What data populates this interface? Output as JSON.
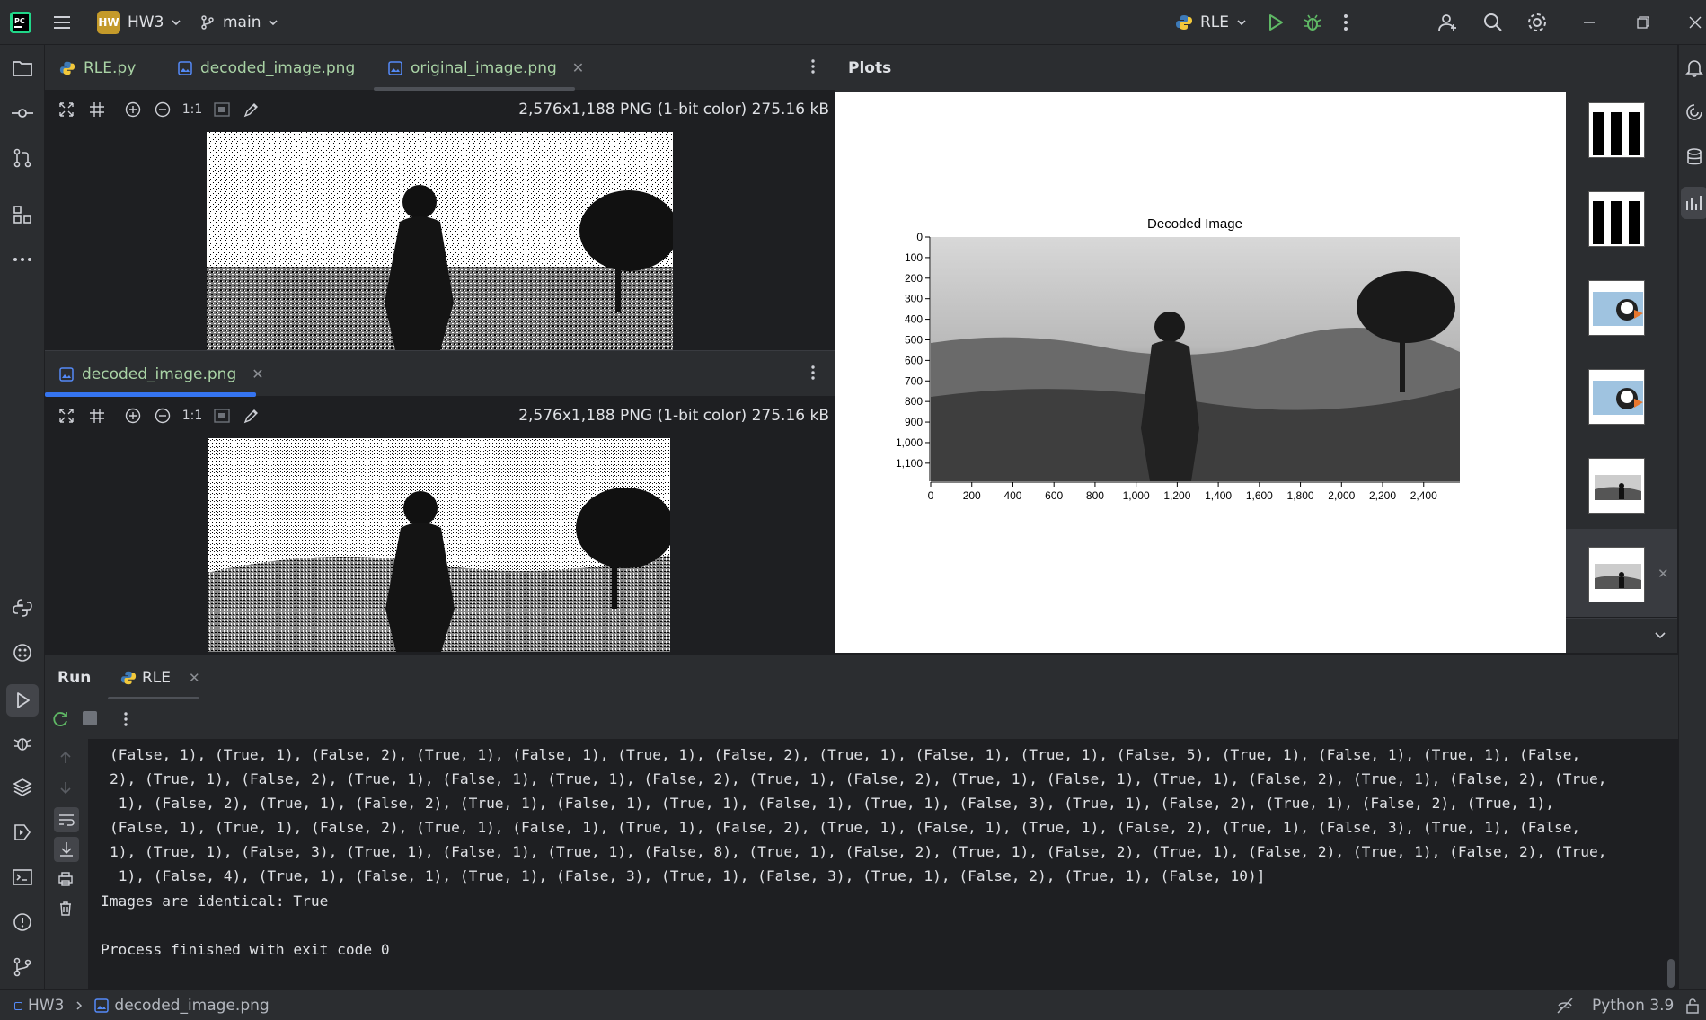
{
  "window": {
    "project_badge": "HW",
    "project_name": "HW3",
    "branch": "main",
    "run_config": "RLE"
  },
  "editor_top": {
    "tabs": [
      {
        "label": "RLE.py",
        "icon": "python-file-icon"
      },
      {
        "label": "decoded_image.png",
        "icon": "image-file-icon"
      },
      {
        "label": "original_image.png",
        "icon": "image-file-icon",
        "active": true
      }
    ],
    "zoom_label": "1:1",
    "image_info": "2,576x1,188 PNG (1-bit color) 275.16 kB"
  },
  "editor_bottom": {
    "tabs": [
      {
        "label": "decoded_image.png",
        "icon": "image-file-icon",
        "active": true
      }
    ],
    "zoom_label": "1:1",
    "image_info": "2,576x1,188 PNG (1-bit color) 275.16 kB"
  },
  "plots": {
    "header": "Plots",
    "thumbnails": [
      "bars-plot",
      "bars-plot",
      "puffin-image",
      "puffin-image",
      "decoded-image-plot",
      "decoded-image-plot"
    ]
  },
  "chart_data": {
    "type": "image",
    "title": "Decoded Image",
    "x_ticks": [
      "0",
      "200",
      "400",
      "600",
      "800",
      "1,000",
      "1,200",
      "1,400",
      "1,600",
      "1,800",
      "2,000",
      "2,200",
      "2,400"
    ],
    "y_ticks": [
      "0",
      "100",
      "200",
      "300",
      "400",
      "500",
      "600",
      "700",
      "800",
      "900",
      "1,000",
      "1,100"
    ],
    "xlim": [
      0,
      2576
    ],
    "ylim": [
      1188,
      0
    ]
  },
  "run": {
    "title": "Run",
    "tab_label": "RLE",
    "output": [
      "(False, 1), (True, 1), (False, 2), (True, 1), (False, 1), (True, 1), (False, 2), (True, 1), (False, 1), (True, 1), (False, 5), (True, 1), (False, 1), (True, 1), (False,",
      "2), (True, 1), (False, 2), (True, 1), (False, 1), (True, 1), (False, 2), (True, 1), (False, 2), (True, 1), (False, 1), (True, 1), (False, 2), (True, 1), (False, 2), (True,",
      " 1), (False, 2), (True, 1), (False, 2), (True, 1), (False, 1), (True, 1), (False, 1), (True, 1), (False, 3), (True, 1), (False, 2), (True, 1), (False, 2), (True, 1),",
      "(False, 1), (True, 1), (False, 2), (True, 1), (False, 1), (True, 1), (False, 2), (True, 1), (False, 1), (True, 1), (False, 2), (True, 1), (False, 3), (True, 1), (False,",
      "1), (True, 1), (False, 3), (True, 1), (False, 1), (True, 1), (False, 8), (True, 1), (False, 2), (True, 1), (False, 2), (True, 1), (False, 2), (True, 1), (False, 2), (True,",
      " 1), (False, 4), (True, 1), (False, 1), (True, 1), (False, 3), (True, 1), (False, 3), (True, 1), (False, 2), (True, 1), (False, 10)]",
      "Images are identical: True",
      "",
      "Process finished with exit code 0"
    ]
  },
  "status": {
    "breadcrumb_project": "HW3",
    "breadcrumb_file": "decoded_image.png",
    "interpreter": "Python 3.9"
  }
}
